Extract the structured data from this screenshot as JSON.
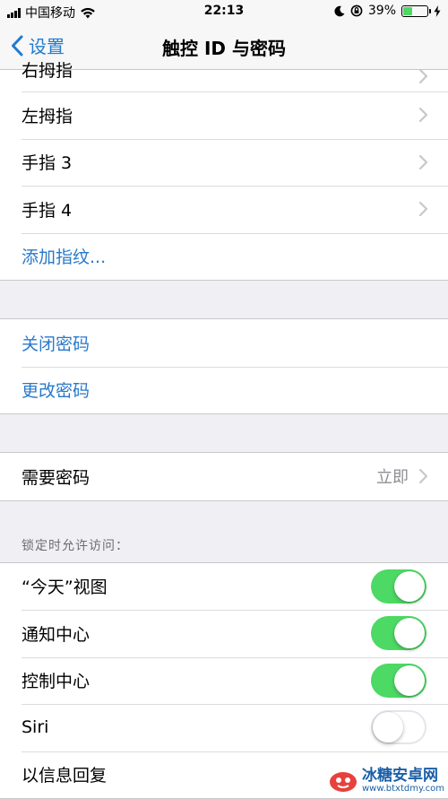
{
  "status": {
    "carrier": "中国移动",
    "time": "22:13",
    "battery_pct": "39%",
    "battery_level": 0.39,
    "battery_color": "#4cd964"
  },
  "nav": {
    "back_label": "设置",
    "title": "触控 ID 与密码"
  },
  "fingerprints": [
    {
      "label": "右拇指"
    },
    {
      "label": "左拇指"
    },
    {
      "label": "手指 3"
    },
    {
      "label": "手指 4"
    }
  ],
  "add_fingerprint": "添加指纹...",
  "passcode": {
    "turn_off": "关闭密码",
    "change": "更改密码"
  },
  "require_passcode": {
    "label": "需要密码",
    "value": "立即"
  },
  "locked_access": {
    "header": "锁定时允许访问：",
    "items": [
      {
        "label": "“今天”视图",
        "on": true
      },
      {
        "label": "通知中心",
        "on": true
      },
      {
        "label": "控制中心",
        "on": true
      },
      {
        "label": "Siri",
        "on": false
      },
      {
        "label": "以信息回复"
      }
    ]
  },
  "watermark": {
    "title": "冰糖安卓网",
    "url": "www.btxtdmy.com"
  },
  "colors": {
    "accent": "#1f7bd1",
    "toggle_on": "#4cd964"
  }
}
